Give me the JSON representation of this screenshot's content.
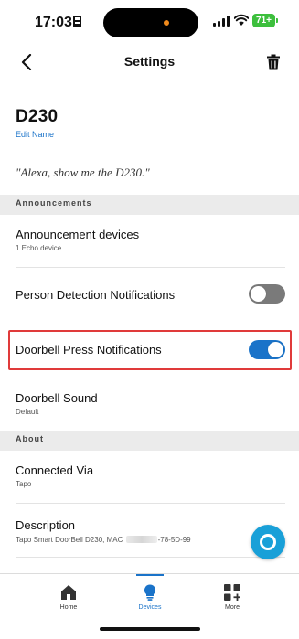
{
  "status_bar": {
    "time": "17:03",
    "battery": "71+",
    "colors": {
      "battery": "#3dbf3d",
      "island_dot": "#f08a1c"
    }
  },
  "header": {
    "title": "Settings",
    "back_icon": "chevron-left-icon",
    "delete_icon": "trash-icon"
  },
  "device": {
    "name": "D230",
    "edit_label": "Edit Name",
    "alexa_phrase": "\"Alexa, show me the D230.\""
  },
  "sections": {
    "announcements": "Announcements",
    "about": "About"
  },
  "rows": {
    "announcement_devices": {
      "title": "Announcement devices",
      "subtitle": "1 Echo device"
    },
    "person_detection": {
      "title": "Person Detection Notifications",
      "enabled": false
    },
    "doorbell_press": {
      "title": "Doorbell Press Notifications",
      "enabled": true
    },
    "doorbell_sound": {
      "title": "Doorbell Sound",
      "subtitle": "Default"
    },
    "connected_via": {
      "title": "Connected Via",
      "subtitle": "Tapo"
    },
    "description": {
      "title": "Description",
      "subtitle_prefix": "Tapo Smart DoorBell D230, MAC ",
      "subtitle_suffix": "-78-5D-99"
    }
  },
  "bottom_nav": {
    "items": [
      {
        "label": "Home",
        "icon": "home-icon",
        "active": false
      },
      {
        "label": "Devices",
        "icon": "lightbulb-icon",
        "active": true
      },
      {
        "label": "More",
        "icon": "grid-plus-icon",
        "active": false
      }
    ]
  },
  "alexa_button": {
    "icon": "alexa-ring-icon"
  },
  "colors": {
    "accent": "#1a73c9",
    "toggle_off": "#7a7a7a",
    "highlight": "#e03a3a",
    "alexa": "#19a0d8",
    "section_bg": "#ebebeb"
  }
}
